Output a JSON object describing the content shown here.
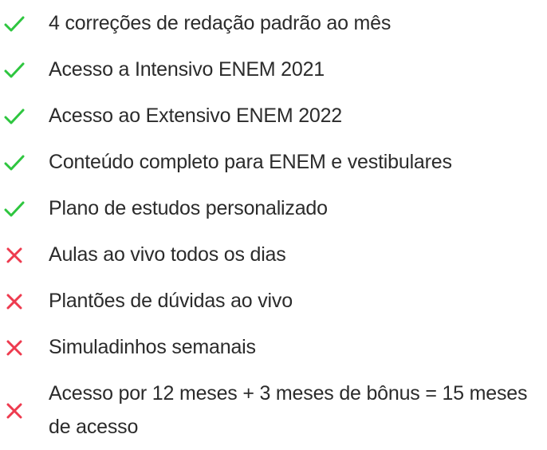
{
  "colors": {
    "included": "#2ec63f",
    "excluded": "#ee3b4f",
    "text": "#2b2b2b"
  },
  "features": [
    {
      "label": "4 correções de redação padrão ao mês",
      "status": "included",
      "icon": "check-icon"
    },
    {
      "label": "Acesso a Intensivo ENEM 2021",
      "status": "included",
      "icon": "check-icon"
    },
    {
      "label": "Acesso ao Extensivo ENEM 2022",
      "status": "included",
      "icon": "check-icon"
    },
    {
      "label": "Conteúdo completo para ENEM e vestibulares",
      "status": "included",
      "icon": "check-icon"
    },
    {
      "label": "Plano de estudos personalizado",
      "status": "included",
      "icon": "check-icon"
    },
    {
      "label": "Aulas ao vivo todos os dias",
      "status": "excluded",
      "icon": "cross-icon"
    },
    {
      "label": "Plantões de dúvidas ao vivo",
      "status": "excluded",
      "icon": "cross-icon"
    },
    {
      "label": "Simuladinhos semanais",
      "status": "excluded",
      "icon": "cross-icon"
    },
    {
      "label": "Acesso por 12 meses + 3 meses de bônus = 15 meses de acesso",
      "status": "excluded",
      "icon": "cross-icon"
    }
  ]
}
